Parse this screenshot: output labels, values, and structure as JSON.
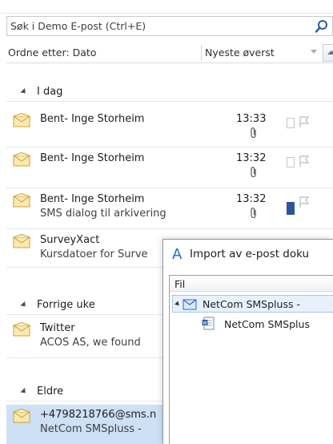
{
  "search": {
    "placeholder": "Søk i Demo E-post (Ctrl+E)",
    "icon": "search-icon"
  },
  "sort": {
    "label": "Ordne etter: Dato",
    "order": "Nyeste øverst"
  },
  "groups": [
    {
      "label": "I dag"
    },
    {
      "label": "Forrige uke"
    },
    {
      "label": "Eldre"
    }
  ],
  "messages": [
    {
      "sender": "Bent- Inge Storheim",
      "subject": "",
      "time": "13:33",
      "attachment": true,
      "category": "empty"
    },
    {
      "sender": "Bent- Inge Storheim",
      "subject": "",
      "time": "13:32",
      "attachment": true,
      "category": "empty"
    },
    {
      "sender": "Bent- Inge Storheim",
      "subject": "SMS dialog til arkivering",
      "time": "13:32",
      "attachment": true,
      "category": "blue"
    },
    {
      "sender": "SurveyXact",
      "subject": "Kursdatoer for Surve",
      "time": "",
      "attachment": false,
      "category": "none"
    },
    {
      "sender": "Twitter",
      "subject": "ACOS AS, we found",
      "time": "",
      "attachment": false,
      "category": "none"
    },
    {
      "sender": "+4798218766@sms.n",
      "subject": "NetCom SMSpluss -",
      "time": "",
      "attachment": false,
      "category": "none"
    }
  ],
  "dialog": {
    "title": "Import av e-post doku",
    "column_header": "Fil",
    "tree": [
      {
        "label": "NetCom SMSpluss -"
      },
      {
        "label": "NetCom SMSplus"
      }
    ]
  },
  "colors": {
    "selection": "#cde0f5",
    "category_blue": "#2b579a",
    "accent": "#1f6fd8"
  }
}
